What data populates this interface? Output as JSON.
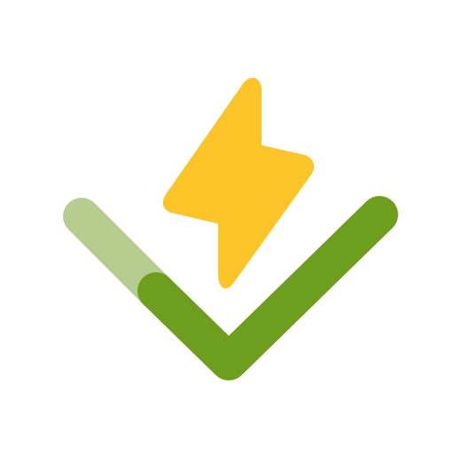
{
  "logo": {
    "icon_name": "lightning-bolt-check-icon",
    "colors": {
      "background": "#ffffff",
      "bolt": "#FBC52A",
      "check_light": "#B5CE8F",
      "check_dark": "#6E9E1E"
    }
  }
}
